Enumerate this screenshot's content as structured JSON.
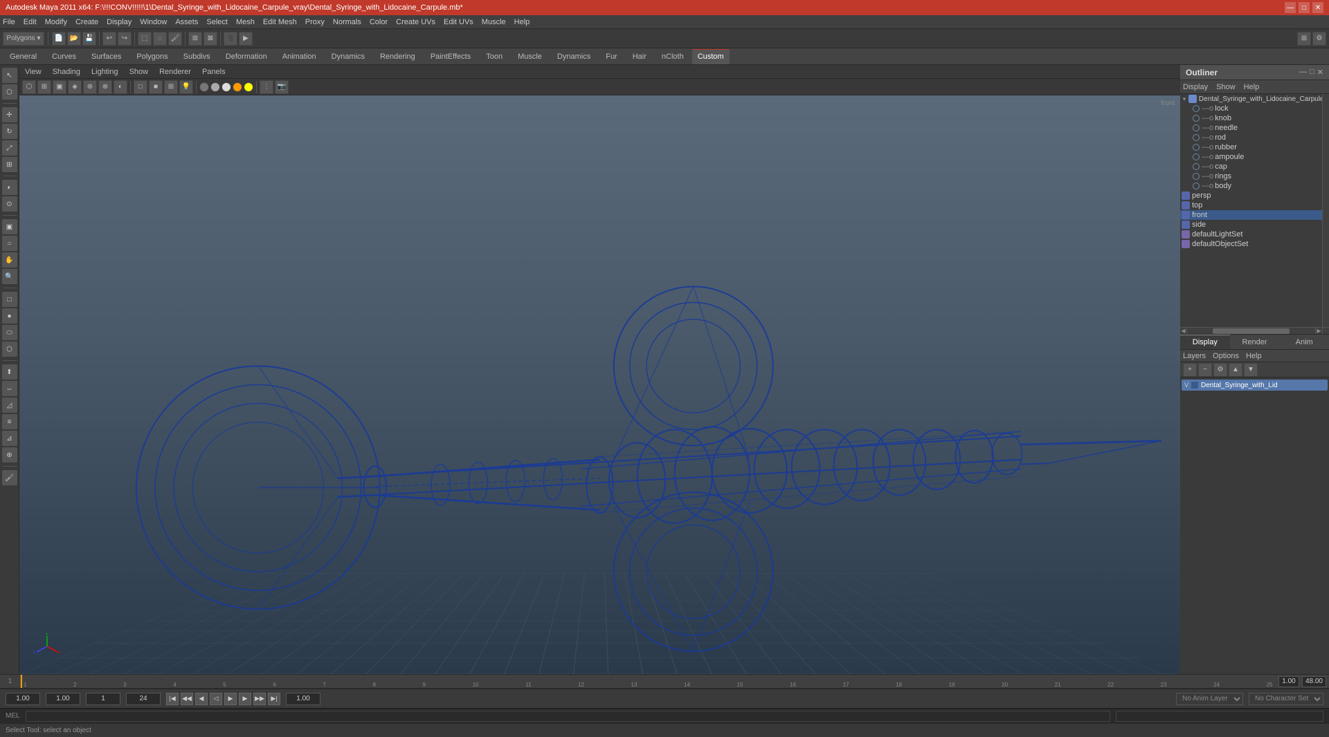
{
  "titleBar": {
    "title": "Autodesk Maya 2011 x64: F:\\!!!CONV!!!!!\\1\\Dental_Syringe_with_Lidocaine_Carpule_vray\\Dental_Syringe_with_Lidocaine_Carpule.mb*",
    "minimize": "—",
    "maximize": "□",
    "close": "✕"
  },
  "menuBar": {
    "items": [
      "File",
      "Edit",
      "Modify",
      "Create",
      "Display",
      "Window",
      "Assets",
      "Select",
      "Mesh",
      "Edit Mesh",
      "Proxy",
      "Normals",
      "Color",
      "Create UVs",
      "Edit UVs",
      "Muscle",
      "Help"
    ]
  },
  "tabs": {
    "items": [
      "General",
      "Curves",
      "Surfaces",
      "Polygons",
      "Subdivs",
      "Deformation",
      "Animation",
      "Dynamics",
      "Rendering",
      "PaintEffects",
      "Toon",
      "Muscle",
      "Dynamics",
      "Fur",
      "Hair",
      "nCloth",
      "Custom"
    ],
    "active": "Custom"
  },
  "viewportMenu": {
    "items": [
      "View",
      "Shading",
      "Lighting",
      "Show",
      "Renderer",
      "Panels"
    ]
  },
  "outliner": {
    "title": "Outliner",
    "menuItems": [
      "Display",
      "Show",
      "Help"
    ],
    "tree": [
      {
        "label": "Dental_Syringe_with_Lidocaine_Carpule",
        "level": 0,
        "icon": "group",
        "expanded": true
      },
      {
        "label": "lock",
        "level": 1,
        "icon": "mesh"
      },
      {
        "label": "knob",
        "level": 1,
        "icon": "mesh"
      },
      {
        "label": "needle",
        "level": 1,
        "icon": "mesh"
      },
      {
        "label": "rod",
        "level": 1,
        "icon": "mesh"
      },
      {
        "label": "rubber",
        "level": 1,
        "icon": "mesh"
      },
      {
        "label": "ampoule",
        "level": 1,
        "icon": "mesh"
      },
      {
        "label": "cap",
        "level": 1,
        "icon": "mesh"
      },
      {
        "label": "rings",
        "level": 1,
        "icon": "mesh"
      },
      {
        "label": "body",
        "level": 1,
        "icon": "mesh"
      },
      {
        "label": "persp",
        "level": 0,
        "icon": "camera"
      },
      {
        "label": "top",
        "level": 0,
        "icon": "camera"
      },
      {
        "label": "front",
        "level": 0,
        "icon": "camera",
        "selected": true
      },
      {
        "label": "side",
        "level": 0,
        "icon": "camera"
      },
      {
        "label": "defaultLightSet",
        "level": 0,
        "icon": "set"
      },
      {
        "label": "defaultObjectSet",
        "level": 0,
        "icon": "set"
      }
    ]
  },
  "displayPanel": {
    "tabs": [
      "Display",
      "Render",
      "Anim"
    ],
    "activeTab": "Display",
    "menuItems": [
      "Layers",
      "Options",
      "Help"
    ],
    "layerName": "Dental_Syringe_with_Lid"
  },
  "timeline": {
    "startFrame": "1",
    "endFrame": "24",
    "currentFrame": "1",
    "playbackStart": "1.00",
    "playbackEnd": "24.00",
    "rangeStart": "1.00",
    "rangeEnd": "48.00",
    "rulerMarks": [
      "1",
      "2",
      "3",
      "4",
      "5",
      "6",
      "7",
      "8",
      "9",
      "10",
      "11",
      "12",
      "13",
      "14",
      "15",
      "16",
      "17",
      "18",
      "19",
      "20",
      "21",
      "22",
      "23",
      "24",
      "25"
    ]
  },
  "bottomBar": {
    "frameStart": "1.00",
    "frameEnd": "1.00",
    "frameStep": "1",
    "frameEnd2": "24",
    "noAnimLayer": "No Anim Layer",
    "characterSet": "No Character Set"
  },
  "statusBar": {
    "text": "Select Tool: select an object"
  },
  "commandLine": {
    "label": "MEL",
    "placeholder": ""
  }
}
